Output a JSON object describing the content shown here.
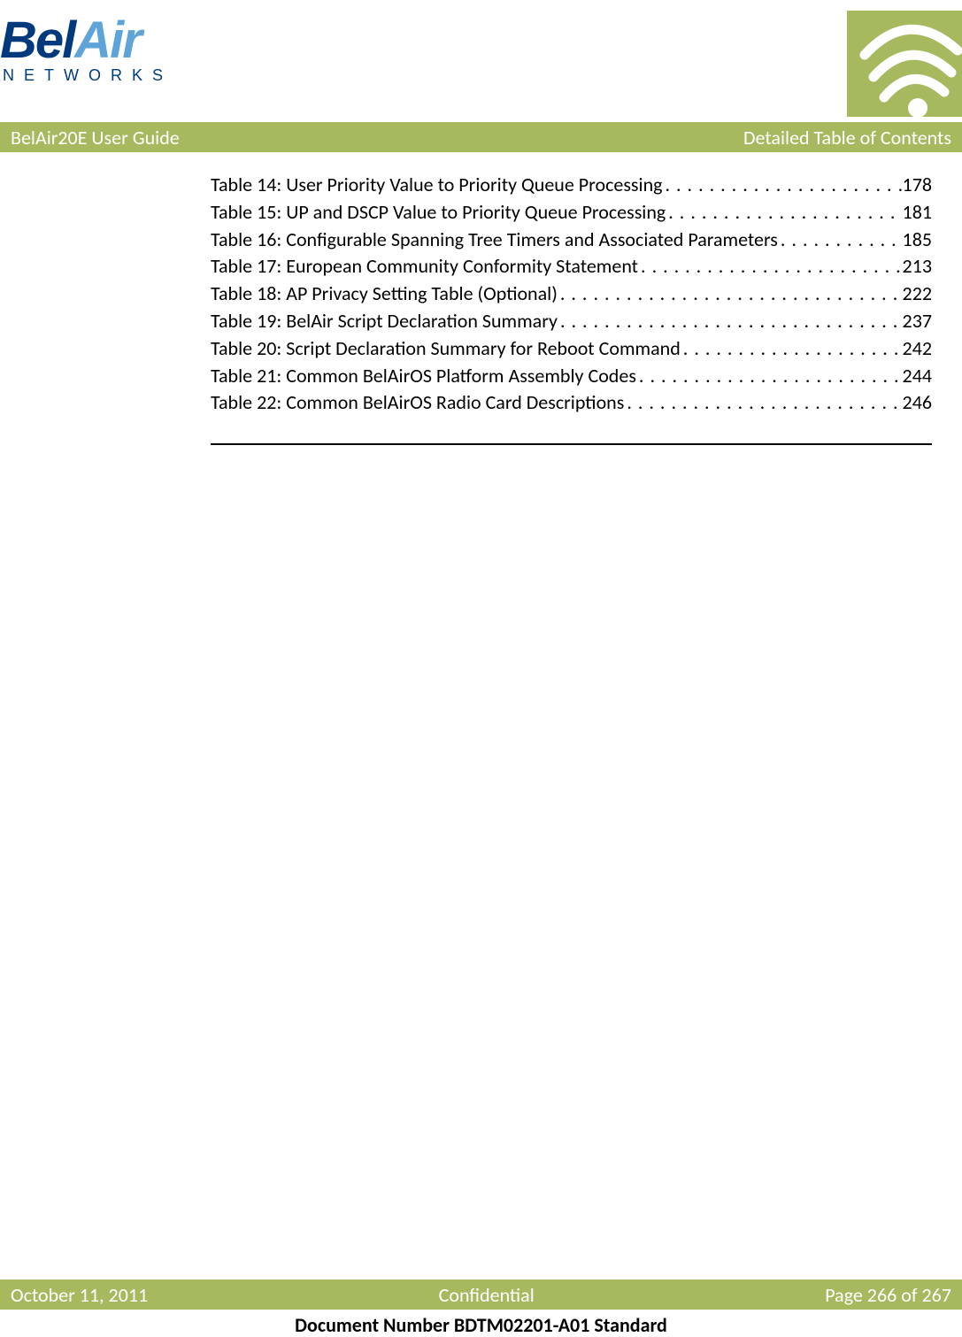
{
  "logo": {
    "brand_bel": "Bel",
    "brand_air": "Air",
    "networks": "NETWORKS"
  },
  "banner": {
    "left": "BelAir20E User Guide",
    "right": "Detailed Table of Contents"
  },
  "toc": [
    {
      "label": "Table 14: User Priority Value to Priority Queue Processing",
      "page": "178"
    },
    {
      "label": "Table 15: UP and DSCP Value to Priority Queue Processing",
      "page": "181"
    },
    {
      "label": "Table 16: Configurable Spanning Tree Timers and Associated Parameters",
      "page": "185"
    },
    {
      "label": "Table 17: European Community Conformity Statement",
      "page": "213"
    },
    {
      "label": "Table 18: AP Privacy Setting Table (Optional)",
      "page": "222"
    },
    {
      "label": "Table 19: BelAir Script Declaration Summary",
      "page": "237"
    },
    {
      "label": "Table 20: Script Declaration Summary for Reboot Command",
      "page": "242"
    },
    {
      "label": "Table 21: Common BelAirOS Platform Assembly Codes",
      "page": "244"
    },
    {
      "label": "Table 22: Common BelAirOS Radio Card Descriptions",
      "page": "246"
    }
  ],
  "footer": {
    "date": "October 11, 2011",
    "confidential": "Confidential",
    "page": "Page 266 of 267",
    "docnum": "Document Number BDTM02201-A01 Standard"
  }
}
